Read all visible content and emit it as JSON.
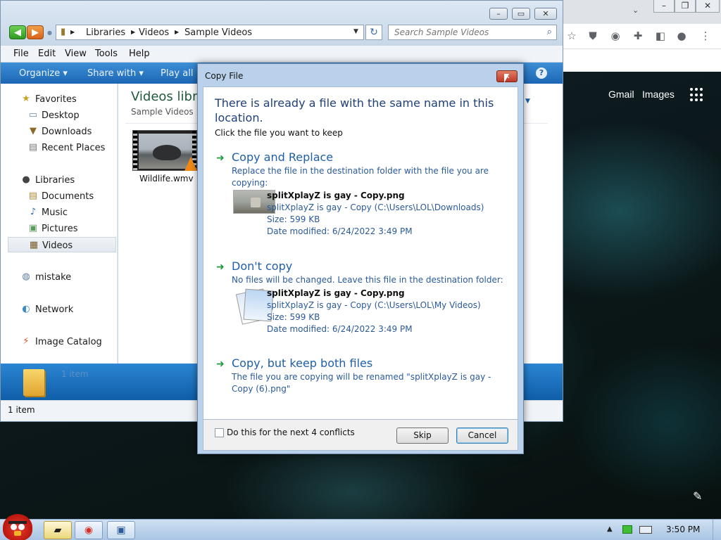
{
  "chrome": {
    "links": {
      "gmail": "Gmail",
      "images": "Images"
    },
    "controls": {
      "minimize": "–",
      "restore": "❐",
      "close": "✕"
    }
  },
  "explorer": {
    "address": {
      "crumbs": [
        "Libraries",
        "Videos",
        "Sample Videos"
      ]
    },
    "search": {
      "placeholder": "Search Sample Videos"
    },
    "menu": [
      "File",
      "Edit",
      "View",
      "Tools",
      "Help"
    ],
    "commands": {
      "organize": "Organize ▾",
      "share": "Share with ▾",
      "play_all": "Play all"
    },
    "nav": {
      "favorites": "Favorites",
      "desktop": "Desktop",
      "downloads": "Downloads",
      "recent": "Recent Places",
      "libraries": "Libraries",
      "documents": "Documents",
      "music": "Music",
      "pictures": "Pictures",
      "videos": "Videos",
      "mistake": "mistake",
      "network": "Network",
      "image_catalog": "Image Catalog"
    },
    "content": {
      "title": "Videos libra",
      "subtitle": "Sample Videos",
      "file_name": "Wildlife.wmv"
    },
    "details_count": "1 item",
    "status": "1 item"
  },
  "dialog": {
    "title": "Copy File",
    "heading": "There is already a file with the same name in this location.",
    "instruction": "Click the file you want to keep",
    "options": {
      "replace": {
        "title": "Copy and Replace",
        "desc": "Replace the file in the destination folder with the file you are copying:",
        "file_name": "splitXplayZ is gay - Copy.png",
        "file_path": "splitXplayZ is gay - Copy (C:\\Users\\LOL\\Downloads)",
        "size": "Size: 599 KB",
        "modified": "Date modified: 6/24/2022 3:49 PM"
      },
      "dont_copy": {
        "title": "Don't copy",
        "desc": "No files will be changed. Leave this file in the destination folder:",
        "file_name": "splitXplayZ is gay - Copy.png",
        "file_path": "splitXplayZ is gay - Copy (C:\\Users\\LOL\\My Videos)",
        "size": "Size: 599 KB",
        "modified": "Date modified: 6/24/2022 3:49 PM"
      },
      "keep_both": {
        "title": "Copy, but keep both files",
        "desc": "The file you are copying will be renamed \"splitXplayZ is gay - Copy (6).png\""
      }
    },
    "checkbox_label": "Do this for the next 4 conflicts",
    "skip": "Skip",
    "cancel": "Cancel"
  },
  "taskbar": {
    "clock": "3:50 PM"
  }
}
